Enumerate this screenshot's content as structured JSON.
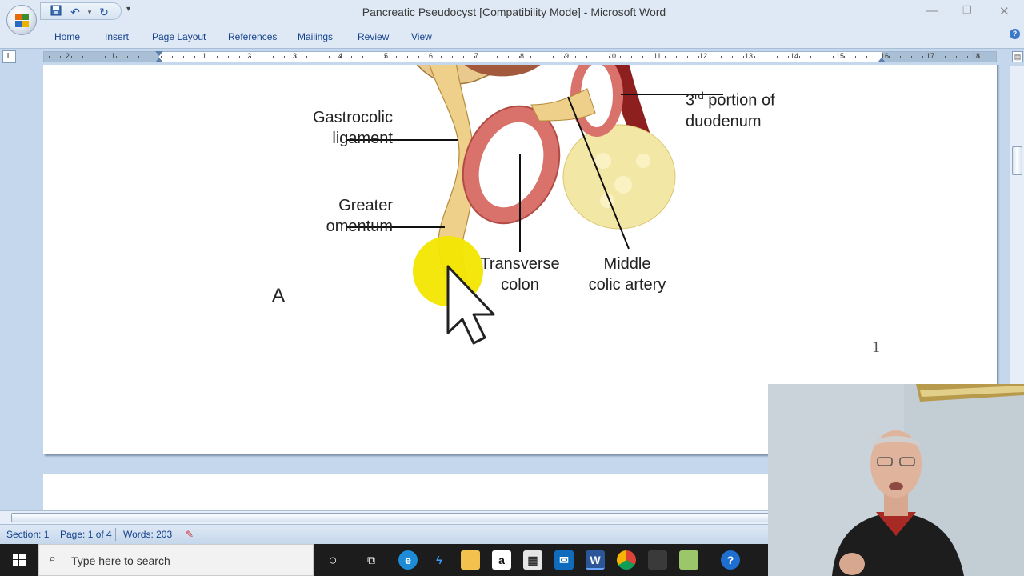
{
  "window": {
    "title": "Pancreatic Pseudocyst [Compatibility Mode] - Microsoft Word",
    "controls": [
      "minimize-icon",
      "restore-icon",
      "close-icon"
    ]
  },
  "quick_access": {
    "items": [
      "save-icon",
      "undo-icon",
      "redo-icon"
    ],
    "more": "▾"
  },
  "ribbon": {
    "tabs": [
      "Home",
      "Insert",
      "Page Layout",
      "References",
      "Mailings",
      "Review",
      "View"
    ]
  },
  "ruler": {
    "numbers": [
      "2",
      "1",
      "1",
      "2",
      "3",
      "4",
      "5",
      "6",
      "7",
      "8",
      "9",
      "10",
      "11",
      "12",
      "13",
      "14",
      "15",
      "16",
      "17",
      "18"
    ],
    "tab_selector": "L"
  },
  "figure": {
    "labels": {
      "gastrocolic_1": "Gastrocolic",
      "gastrocolic_2": "ligament",
      "greater_1": "Greater",
      "greater_2": "omentum",
      "transverse_1": "Transverse",
      "transverse_2": "colon",
      "middle_1": "Middle",
      "middle_2": "colic artery",
      "duodenum_pre": "3",
      "duodenum_sup": "rd",
      "duodenum_1": " portion of",
      "duodenum_2": "duodenum",
      "panel": "A"
    },
    "page_number": "1"
  },
  "status": {
    "section": "Section: 1",
    "page": "Page: 1 of 4",
    "words": "Words: 203"
  },
  "taskbar": {
    "search_placeholder": "Type here to search",
    "apps": [
      "cortana-icon",
      "task-view-icon",
      "edge-icon",
      "app-icon",
      "file-explorer-icon",
      "amazon-icon",
      "store-icon",
      "mail-icon",
      "word-icon",
      "chrome-icon",
      "app-icon-2",
      "app-icon-3",
      "help-icon"
    ]
  },
  "colors": {
    "ribbon_bg": "#dfe9f5",
    "tab_text": "#15428b",
    "doc_bg": "#c5d7ec",
    "highlight": "#f2e600",
    "colon_red": "#d9726a"
  }
}
